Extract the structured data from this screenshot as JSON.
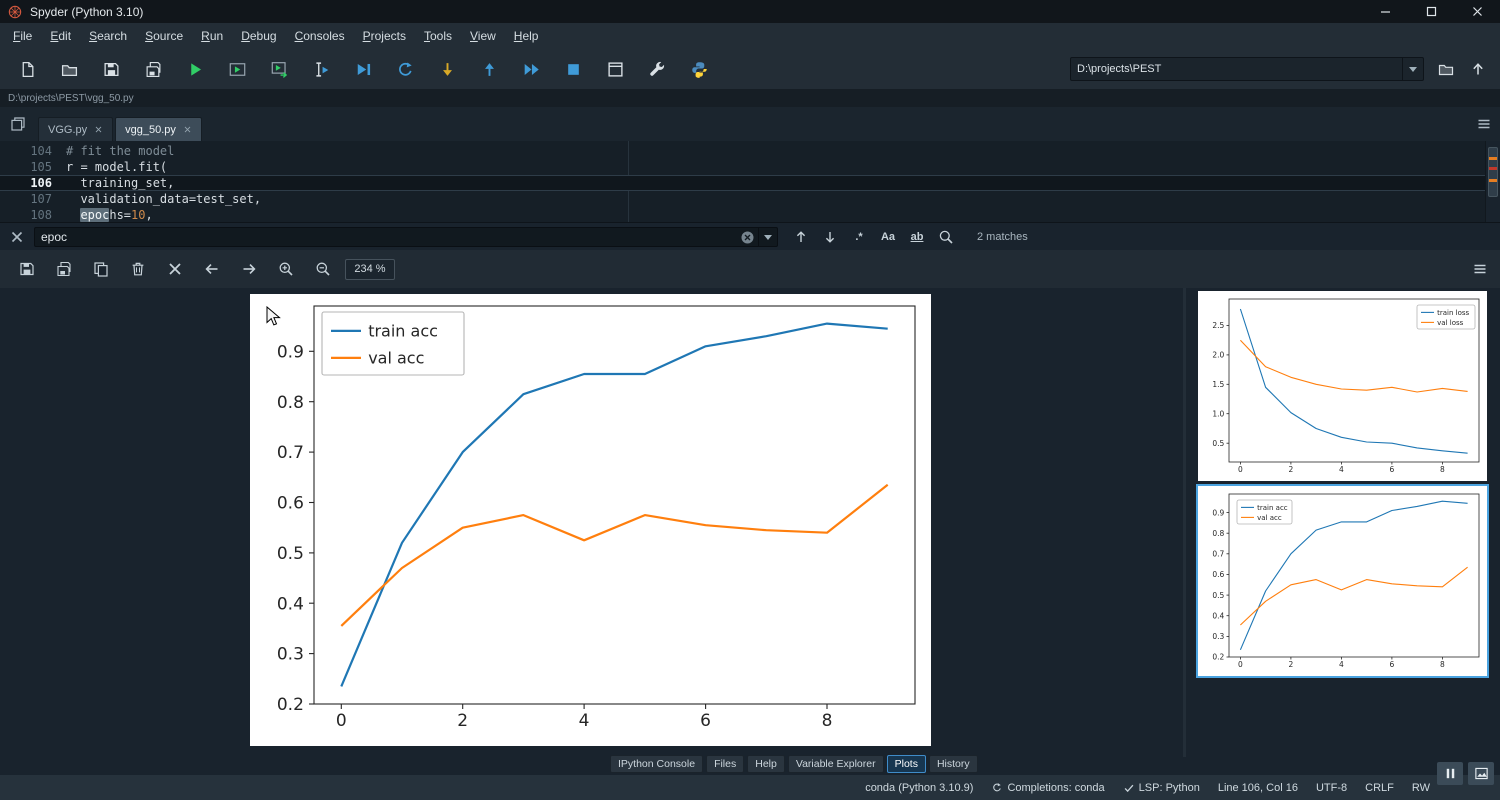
{
  "titlebar": {
    "title": "Spyder (Python 3.10)"
  },
  "menubar": {
    "items": [
      "File",
      "Edit",
      "Search",
      "Source",
      "Run",
      "Debug",
      "Consoles",
      "Projects",
      "Tools",
      "View",
      "Help"
    ]
  },
  "toolbar": {
    "icons": [
      {
        "name": "new-file-icon",
        "kind": "file",
        "color": "#d9e0e5"
      },
      {
        "name": "open-file-icon",
        "kind": "folder",
        "color": "#d9e0e5"
      },
      {
        "name": "save-icon",
        "kind": "save",
        "color": "#d9e0e5"
      },
      {
        "name": "save-all-icon",
        "kind": "save-all",
        "color": "#d9e0e5"
      },
      {
        "name": "run-icon",
        "kind": "play",
        "color": "#31ce67"
      },
      {
        "name": "run-cell-icon",
        "kind": "play-box",
        "color": "#31ce67"
      },
      {
        "name": "run-cell-advance-icon",
        "kind": "play-box-arrow",
        "color": "#31ce67"
      },
      {
        "name": "run-selection-icon",
        "kind": "ibeam-play",
        "color": "#3f9bd8"
      },
      {
        "name": "debug-file-icon",
        "kind": "play-pause",
        "color": "#3f9bd8"
      },
      {
        "name": "debug-step-over-icon",
        "kind": "loop",
        "color": "#3f9bd8"
      },
      {
        "name": "step-into-icon",
        "kind": "arrow-down",
        "color": "#d8a927"
      },
      {
        "name": "step-return-icon",
        "kind": "arrow-up",
        "color": "#3f9bd8"
      },
      {
        "name": "continue-icon",
        "kind": "fast-forward",
        "color": "#3f9bd8"
      },
      {
        "name": "stop-icon",
        "kind": "stop",
        "color": "#3f9bd8"
      },
      {
        "name": "maximize-pane-icon",
        "kind": "maximize",
        "color": "#d9e0e5"
      },
      {
        "name": "preferences-icon",
        "kind": "wrench",
        "color": "#d9e0e5"
      },
      {
        "name": "python-env-icon",
        "kind": "python",
        "color": "#ffd43b"
      }
    ],
    "cwd_value": "D:\\projects\\PEST"
  },
  "path_bar": {
    "path": "D:\\projects\\PEST\\vgg_50.py"
  },
  "editor": {
    "tabs": [
      {
        "label": "VGG.py",
        "active": false
      },
      {
        "label": "vgg_50.py",
        "active": true
      }
    ],
    "lines": [
      {
        "num": "104",
        "segments": [
          {
            "t": "# fit the model",
            "c": "comment"
          }
        ]
      },
      {
        "num": "105",
        "segments": [
          {
            "t": "r = model.fit(",
            "c": "code"
          }
        ]
      },
      {
        "num": "106",
        "current": true,
        "segments": [
          {
            "t": "  training_set,",
            "c": "code"
          }
        ]
      },
      {
        "num": "107",
        "segments": [
          {
            "t": "  validation_data=test_set,",
            "c": "code"
          }
        ]
      },
      {
        "num": "108",
        "segments": [
          {
            "t": "  ",
            "c": "code"
          },
          {
            "t": "epoc",
            "c": "match"
          },
          {
            "t": "hs=",
            "c": "code"
          },
          {
            "t": "10",
            "c": "number"
          },
          {
            "t": ",",
            "c": "code"
          }
        ]
      }
    ]
  },
  "findbar": {
    "query": "epoc",
    "buttons": [
      {
        "name": "find-previous-icon",
        "kind": "arrow-up-sm"
      },
      {
        "name": "find-next-icon",
        "kind": "arrow-down-sm"
      },
      {
        "name": "regex-icon",
        "kind": "text",
        "label": ".*"
      },
      {
        "name": "case-sensitive-icon",
        "kind": "text",
        "label": "Aa"
      },
      {
        "name": "whole-words-icon",
        "kind": "text-u",
        "label": "ab"
      },
      {
        "name": "highlight-matches-icon",
        "kind": "search"
      }
    ],
    "matches_label": "2 matches"
  },
  "plots_toolbar": {
    "icons": [
      {
        "name": "save-plot-icon",
        "kind": "save"
      },
      {
        "name": "save-all-plots-icon",
        "kind": "save-all"
      },
      {
        "name": "copy-plot-icon",
        "kind": "copy"
      },
      {
        "name": "remove-plot-icon",
        "kind": "trash"
      },
      {
        "name": "remove-all-plots-icon",
        "kind": "close-big"
      },
      {
        "name": "previous-plot-icon",
        "kind": "arrow-left"
      },
      {
        "name": "next-plot-icon",
        "kind": "arrow-right"
      },
      {
        "name": "zoom-in-icon",
        "kind": "zoom-in"
      },
      {
        "name": "zoom-out-icon",
        "kind": "zoom-out"
      }
    ],
    "zoom_value": "234 %"
  },
  "chart_data": [
    {
      "id": "main-plot",
      "type": "line",
      "title": "",
      "x": [
        0,
        1,
        2,
        3,
        4,
        5,
        6,
        7,
        8,
        9
      ],
      "series": [
        {
          "name": "train acc",
          "color": "#1f77b4",
          "values": [
            0.235,
            0.52,
            0.7,
            0.815,
            0.855,
            0.855,
            0.91,
            0.93,
            0.955,
            0.945
          ]
        },
        {
          "name": "val acc",
          "color": "#ff7f0e",
          "values": [
            0.355,
            0.47,
            0.55,
            0.575,
            0.525,
            0.575,
            0.555,
            0.545,
            0.54,
            0.635
          ]
        }
      ],
      "xlim": [
        -0.45,
        9.45
      ],
      "ylim": [
        0.2,
        0.99
      ],
      "x_ticks": [
        0,
        2,
        4,
        6,
        8
      ],
      "y_ticks": [
        0.2,
        0.3,
        0.4,
        0.5,
        0.6,
        0.7,
        0.8,
        0.9
      ],
      "legend": "upper-left",
      "grid": false
    },
    {
      "id": "loss-thumbnail",
      "type": "line",
      "title": "",
      "x": [
        0,
        1,
        2,
        3,
        4,
        5,
        6,
        7,
        8,
        9
      ],
      "series": [
        {
          "name": "train loss",
          "color": "#1f77b4",
          "values": [
            2.78,
            1.45,
            1.02,
            0.75,
            0.6,
            0.52,
            0.5,
            0.42,
            0.37,
            0.33
          ]
        },
        {
          "name": "val loss",
          "color": "#ff7f0e",
          "values": [
            2.25,
            1.8,
            1.62,
            1.5,
            1.42,
            1.4,
            1.45,
            1.37,
            1.43,
            1.38
          ]
        }
      ],
      "xlim": [
        -0.45,
        9.45
      ],
      "ylim": [
        0.18,
        2.95
      ],
      "x_ticks": [
        0,
        2,
        4,
        6,
        8
      ],
      "y_ticks": [
        0.5,
        1.0,
        1.5,
        2.0,
        2.5
      ],
      "legend": "upper-right",
      "grid": false
    },
    {
      "id": "acc-thumbnail",
      "type": "line",
      "title": "",
      "selected": true,
      "x": [
        0,
        1,
        2,
        3,
        4,
        5,
        6,
        7,
        8,
        9
      ],
      "series": [
        {
          "name": "train acc",
          "color": "#1f77b4",
          "values": [
            0.235,
            0.52,
            0.7,
            0.815,
            0.855,
            0.855,
            0.91,
            0.93,
            0.955,
            0.945
          ]
        },
        {
          "name": "val acc",
          "color": "#ff7f0e",
          "values": [
            0.355,
            0.47,
            0.55,
            0.575,
            0.525,
            0.575,
            0.555,
            0.545,
            0.54,
            0.635
          ]
        }
      ],
      "xlim": [
        -0.45,
        9.45
      ],
      "ylim": [
        0.2,
        0.99
      ],
      "x_ticks": [
        0,
        2,
        4,
        6,
        8
      ],
      "y_ticks": [
        0.2,
        0.3,
        0.4,
        0.5,
        0.6,
        0.7,
        0.8,
        0.9
      ],
      "legend": "upper-left",
      "grid": false
    }
  ],
  "bottom_tabs": {
    "tabs": [
      "IPython Console",
      "Files",
      "Help",
      "Variable Explorer",
      "Plots",
      "History"
    ],
    "active_index": 4
  },
  "statusbar": {
    "items": [
      {
        "name": "interpreter-status",
        "text": "conda (Python 3.10.9)"
      },
      {
        "name": "completions-status",
        "text": "Completions: conda",
        "icon": "sync"
      },
      {
        "name": "lsp-status",
        "text": "LSP: Python",
        "icon": "check"
      },
      {
        "name": "cursor-position-status",
        "text": "Line 106, Col 16"
      },
      {
        "name": "encoding-status",
        "text": "UTF-8"
      },
      {
        "name": "eol-status",
        "text": "CRLF"
      },
      {
        "name": "permissions-status",
        "text": "RW"
      }
    ]
  }
}
